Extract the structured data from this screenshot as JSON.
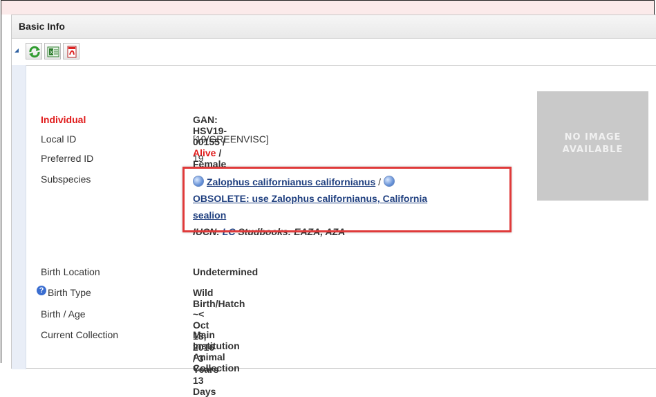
{
  "panel": {
    "title": "Basic Info"
  },
  "toolbar": {
    "buttons": [
      {
        "name": "refresh-button"
      },
      {
        "name": "export-excel-button"
      },
      {
        "name": "export-pdf-button"
      }
    ]
  },
  "individual": {
    "label": "Individual",
    "gan_prefix": "GAN: HSV19-00155 / ",
    "status": "Alive",
    "sex_suffix": " / Female"
  },
  "fields": {
    "local_id": {
      "label": "Local ID",
      "value": "[19/GREENVISC]"
    },
    "preferred_id": {
      "label": "Preferred ID",
      "value": "19"
    },
    "subspecies": {
      "label": "Subspecies",
      "link1": "Zalophus californianus californianus",
      "sep": " / ",
      "link2_line1": "OBSOLETE: use Zalophus californianus, California",
      "link2_line2": "sealion",
      "iucn": "IUCN: ",
      "iucn_value": "LC",
      "studbooks": "  Studbooks: EAZA, AZA"
    },
    "birth_location": {
      "label": "Birth Location",
      "value": "Undetermined"
    },
    "birth_type": {
      "label": "Birth Type",
      "value": "Wild Birth/Hatch",
      "help": "?"
    },
    "birth_age": {
      "label": "Birth / Age",
      "value": "~< Oct 18, 2016 / 3 Years 13 Days"
    },
    "current_collection": {
      "label": "Current Collection",
      "value": "Main Institution Animal Collection"
    }
  },
  "image_placeholder": {
    "line1": "NO IMAGE",
    "line2": "AVAILABLE"
  }
}
